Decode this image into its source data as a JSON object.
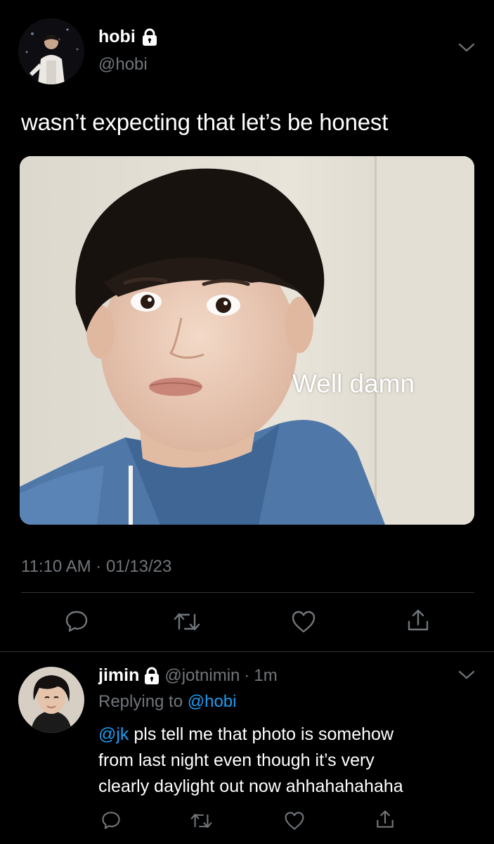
{
  "tweet": {
    "author_name": "hobi",
    "author_handle": "@hobi",
    "text": "wasn’t expecting that let’s be honest",
    "media_caption": "Well damn",
    "timestamp": "11:10 AM · 01/13/23",
    "icons": [
      "lock-icon",
      "chevron-down-icon",
      "reply-icon",
      "retweet-icon",
      "like-icon",
      "share-icon"
    ]
  },
  "reply": {
    "author_name": "jimin",
    "author_handle": "@jotnimin",
    "separator": "·",
    "age": "1m",
    "replying_prefix": "Replying to",
    "replying_to": "@hobi",
    "mention": "@jk",
    "body_line1": " pls tell me that photo is somehow",
    "body_line2": "from last night even though it’s very",
    "body_line3": "clearly daylight out now ahhahahahaha"
  },
  "colors": {
    "background": "#000000",
    "primary_text": "#ffffff",
    "secondary_text": "#71767b",
    "accent": "#1d9bf0",
    "divider": "#2f3336"
  }
}
